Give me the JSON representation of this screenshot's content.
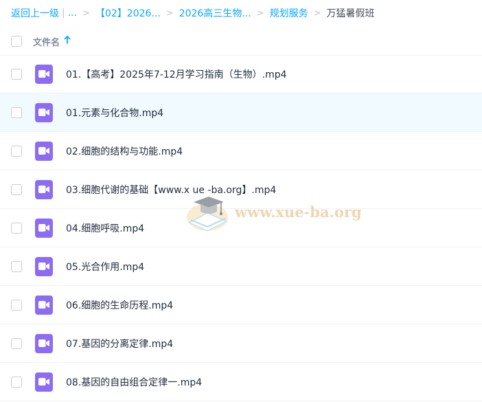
{
  "breadcrumb": {
    "back": "返回上一级",
    "ellipsis": "...",
    "items": [
      "【02】2026...",
      "2026高三生物...",
      "规划服务"
    ],
    "current": "万猛暑假班"
  },
  "header": {
    "column": "文件名"
  },
  "files": [
    {
      "name": "01.【高考】2025年7-12月学习指南（生物）.mp4"
    },
    {
      "name": "01.元素与化合物.mp4"
    },
    {
      "name": "02.细胞的结构与功能.mp4"
    },
    {
      "name": "03.细胞代谢的基础【www.x ue -ba.org】.mp4"
    },
    {
      "name": "04.细胞呼吸.mp4"
    },
    {
      "name": "05.光合作用.mp4"
    },
    {
      "name": "06.细胞的生命历程.mp4"
    },
    {
      "name": "07.基因的分离定律.mp4"
    },
    {
      "name": "08.基因的自由组合定律一.mp4"
    }
  ],
  "watermark": {
    "text": "www.xue-ba.org"
  },
  "colors": {
    "accent": "#06a7ff",
    "video_icon": "#8c6cf2",
    "hover_row": "#f1faff"
  },
  "icons": {
    "file": "video-file-icon",
    "sort": "sort-ascending-icon"
  }
}
